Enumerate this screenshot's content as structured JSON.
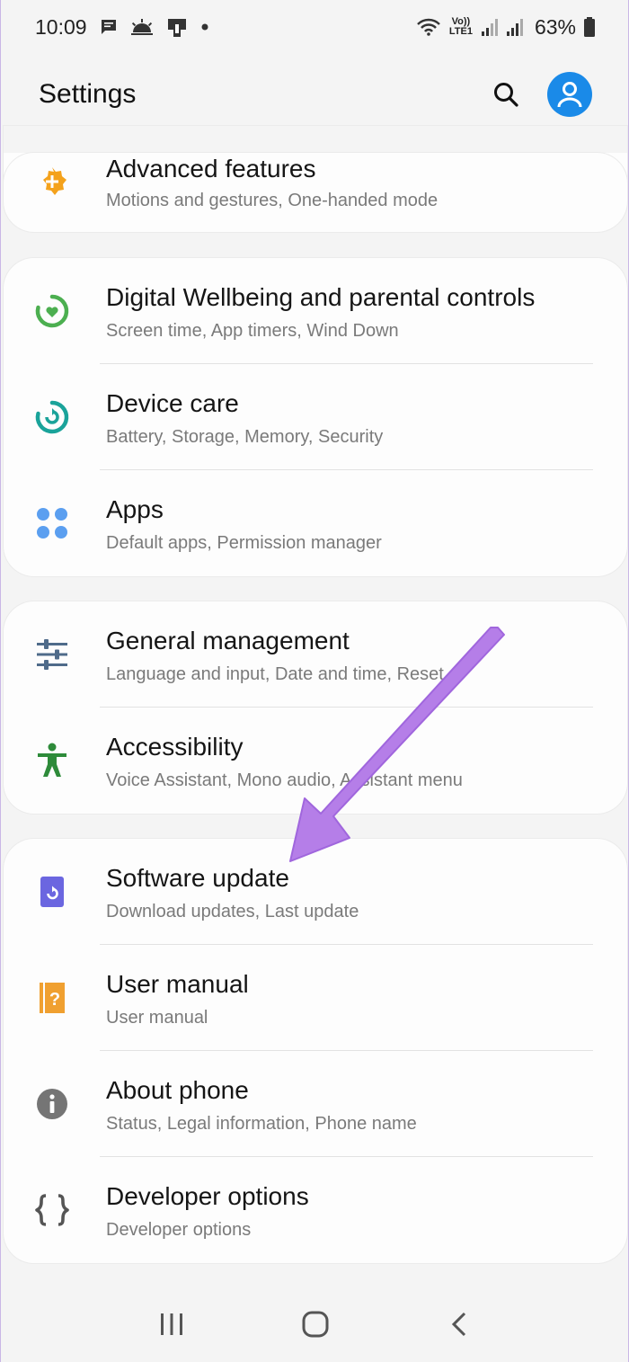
{
  "status_bar": {
    "time": "10:09",
    "battery_percent": "63%",
    "volte_label": "Vo)) LTE1"
  },
  "header": {
    "title": "Settings"
  },
  "sections": [
    {
      "items": [
        {
          "title": "Advanced features",
          "subtitle": "Motions and gestures, One-handed mode",
          "icon": "advanced-features-icon",
          "color": "#f4a21c"
        }
      ]
    },
    {
      "items": [
        {
          "title": "Digital Wellbeing and parental controls",
          "subtitle": "Screen time, App timers, Wind Down",
          "icon": "digital-wellbeing-icon",
          "color": "#4caf50"
        },
        {
          "title": "Device care",
          "subtitle": "Battery, Storage, Memory, Security",
          "icon": "device-care-icon",
          "color": "#1aa39a"
        },
        {
          "title": "Apps",
          "subtitle": "Default apps, Permission manager",
          "icon": "apps-icon",
          "color": "#5b9ff0"
        }
      ]
    },
    {
      "items": [
        {
          "title": "General management",
          "subtitle": "Language and input, Date and time, Reset",
          "icon": "general-management-icon",
          "color": "#4f6b8a"
        },
        {
          "title": "Accessibility",
          "subtitle": "Voice Assistant, Mono audio, Assistant menu",
          "icon": "accessibility-icon",
          "color": "#2e8b3a"
        }
      ]
    },
    {
      "items": [
        {
          "title": "Software update",
          "subtitle": "Download updates, Last update",
          "icon": "software-update-icon",
          "color": "#6b66e0"
        },
        {
          "title": "User manual",
          "subtitle": "User manual",
          "icon": "user-manual-icon",
          "color": "#f0a030"
        },
        {
          "title": "About phone",
          "subtitle": "Status, Legal information, Phone name",
          "icon": "about-phone-icon",
          "color": "#757575"
        },
        {
          "title": "Developer options",
          "subtitle": "Developer options",
          "icon": "developer-options-icon",
          "color": "#555555"
        }
      ]
    }
  ],
  "annotation": {
    "color": "#b57ee8",
    "points_to": "Software update"
  },
  "colors": {
    "background": "#f4f4f4",
    "card": "#fdfdfd",
    "accent": "#1a8ae8"
  }
}
